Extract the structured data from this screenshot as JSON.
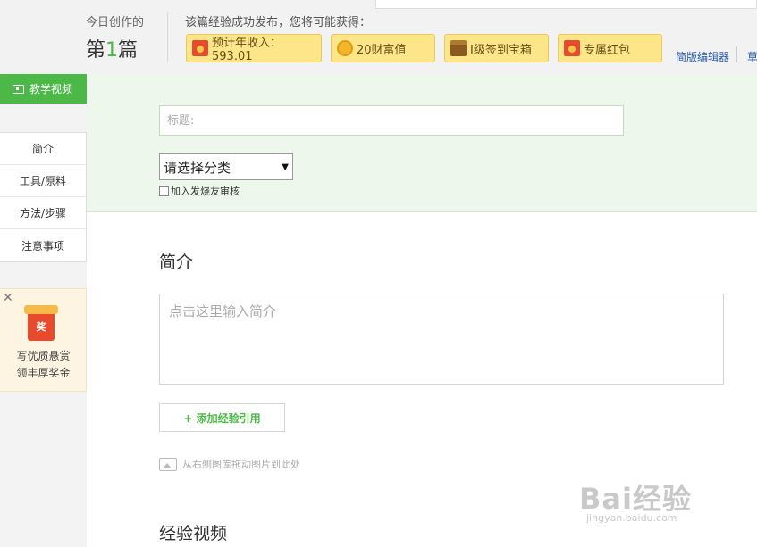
{
  "header": {
    "today_label": "今日创作的",
    "today_prefix": "第",
    "today_number": "1",
    "today_suffix": "篇",
    "reward_title": "该篇经验成功发布，您将可能获得：",
    "rewards": [
      {
        "label": "预计年收入：593.01",
        "icon": "red-envelope-icon"
      },
      {
        "label": "20财富值",
        "icon": "coin-icon"
      },
      {
        "label": "I级签到宝箱",
        "icon": "treasure-chest-icon"
      },
      {
        "label": "专属红包",
        "icon": "red-envelope-icon"
      }
    ],
    "simple_editor_link": "简版编辑器",
    "draft_link": "草"
  },
  "sidebar": {
    "video_button": "教学视频",
    "nav_items": [
      "简介",
      "工具/原料",
      "方法/步骤",
      "注意事项"
    ],
    "promo": {
      "badge": "奖",
      "line1": "写优质悬赏",
      "line2": "领丰厚奖金"
    }
  },
  "main": {
    "title_placeholder": "标题:",
    "category_selected": "请选择分类",
    "review_checkbox_label": "加入发烧友审核",
    "intro_heading": "简介",
    "intro_placeholder": "点击这里输入简介",
    "add_ref_button": "+ 添加经验引用",
    "drag_hint": "从右侧图库拖动图片到此处",
    "video_heading": "经验视频"
  },
  "watermark": {
    "logo": "Bai经验",
    "sub": "jingyan.baidu.com"
  },
  "colors": {
    "accent_green": "#4cb848",
    "panel_green": "#eef7ec",
    "reward_yellow": "#fde58a",
    "link_blue": "#2a5bb0"
  }
}
